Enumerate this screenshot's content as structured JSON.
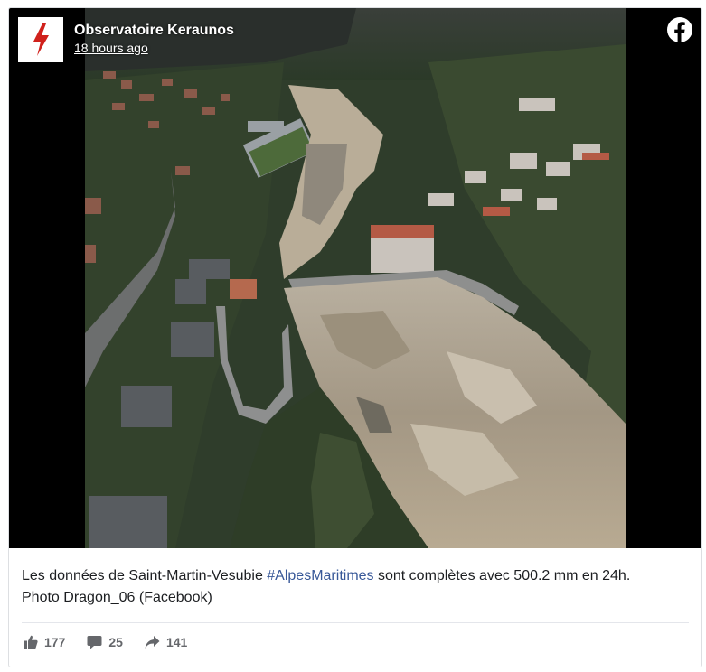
{
  "post": {
    "page_name": "Observatoire Keraunos",
    "timestamp": "18 hours ago",
    "caption_before": "Les données de Saint-Martin-Vesubie ",
    "hashtag": "#AlpesMaritimes",
    "caption_after": " sont complètes avec 500.2 mm en 24h.",
    "caption_line2": "Photo Dragon_06 (Facebook)"
  },
  "stats": {
    "likes": "177",
    "comments": "25",
    "shares": "141"
  },
  "icons": {
    "avatar": "lightning-bolt-icon",
    "platform": "facebook-logo-icon",
    "like": "thumbs-up-icon",
    "comment": "comment-bubble-icon",
    "share": "share-arrow-icon"
  },
  "colors": {
    "hashtag": "#385898",
    "facebook": "#ffffff",
    "avatar_bolt": "#d0211c",
    "text": "#1c1e21",
    "muted": "#65676b"
  }
}
